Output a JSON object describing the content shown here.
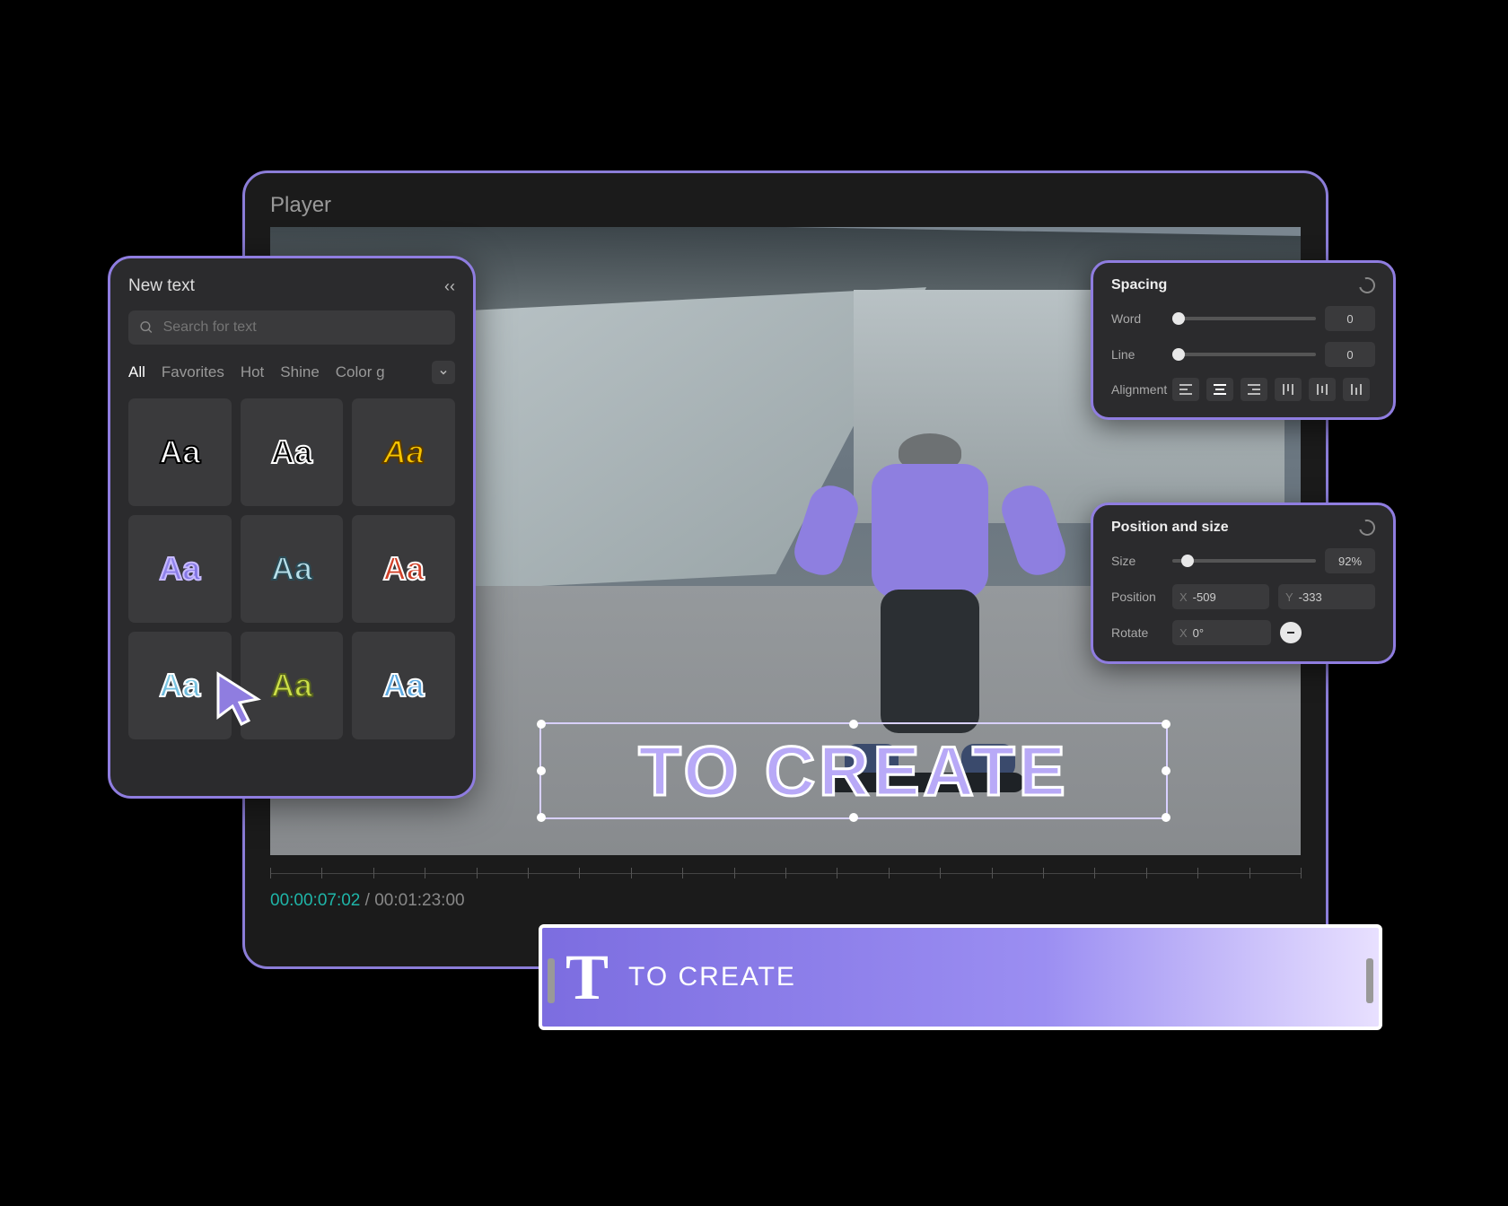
{
  "player": {
    "title": "Player",
    "overlay_text": "TO CREATE",
    "time_current": "00:00:07:02",
    "time_total": "00:01:23:00"
  },
  "newtext": {
    "title": "New text",
    "search_placeholder": "Search for text",
    "tabs": [
      "All",
      "Favorites",
      "Hot",
      "Shine",
      "Color g"
    ],
    "active_tab": "All",
    "sample": "Aa"
  },
  "spacing": {
    "title": "Spacing",
    "word_label": "Word",
    "word_value": "0",
    "line_label": "Line",
    "line_value": "0",
    "alignment_label": "Alignment"
  },
  "position": {
    "title": "Position and size",
    "size_label": "Size",
    "size_value": "92%",
    "position_label": "Position",
    "x_value": "-509",
    "y_value": "-333",
    "rotate_label": "Rotate",
    "rotate_value": "0°",
    "x_axis": "X",
    "y_axis": "Y"
  },
  "clip": {
    "label": "TO CREATE"
  }
}
